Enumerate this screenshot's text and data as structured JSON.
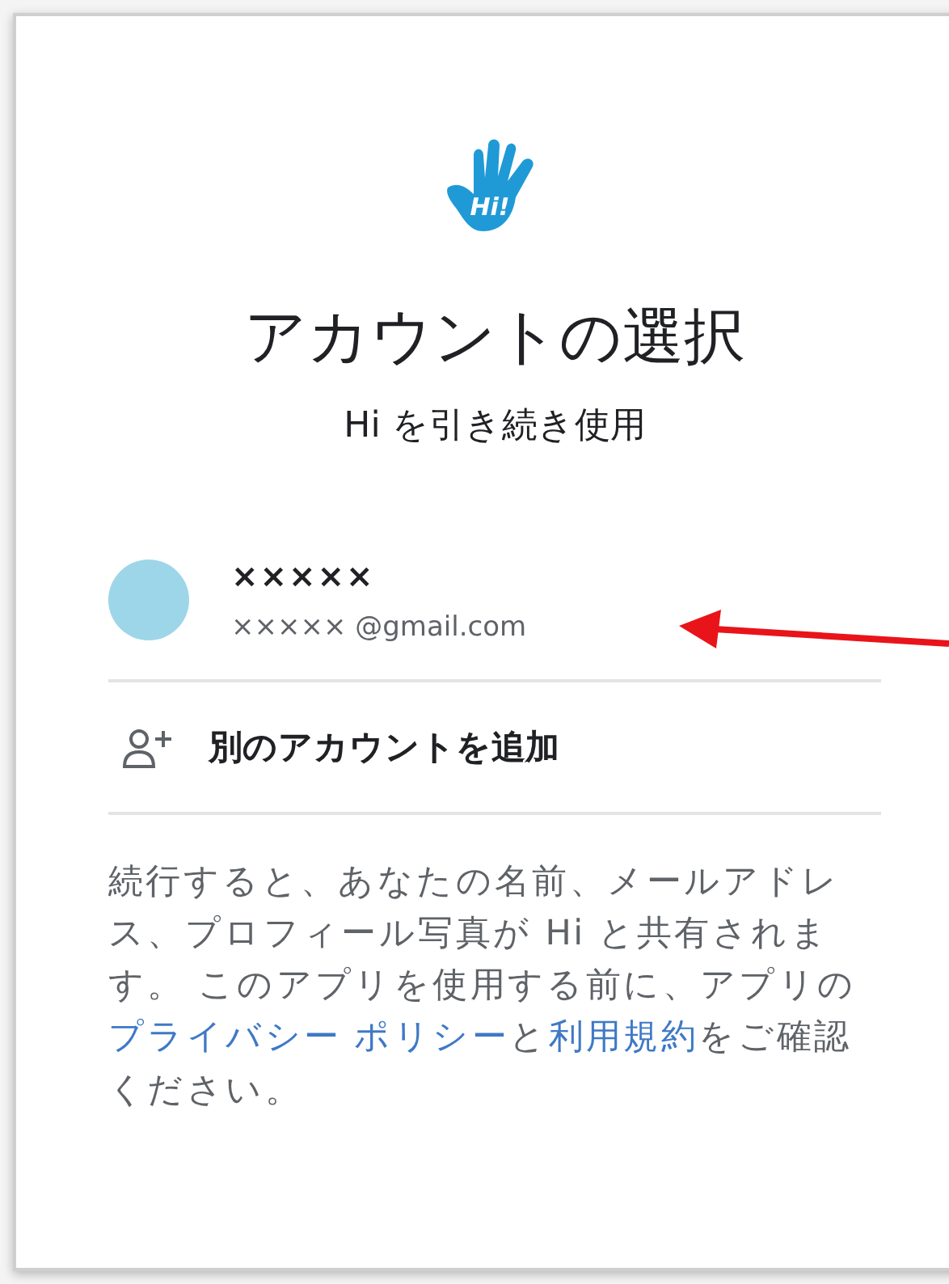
{
  "logo": {
    "text": "Hi!"
  },
  "title": "アカウントの選択",
  "subtitle": "Hi を引き続き使用",
  "accounts": [
    {
      "name": "×××××",
      "email": "××××× @gmail.com"
    }
  ],
  "add_account": {
    "label": "別のアカウントを追加"
  },
  "disclaimer": [
    {
      "kind": "text",
      "text": "続行すると、あなたの名前、メールアドレス、プロフィール写真が Hi と共有されます。 このアプリを使用する前に、アプリの"
    },
    {
      "kind": "link",
      "text": "プライバシー ポリシー"
    },
    {
      "kind": "text",
      "text": "と"
    },
    {
      "kind": "link",
      "text": "利用規約"
    },
    {
      "kind": "text",
      "text": "をご確認ください。"
    }
  ]
}
